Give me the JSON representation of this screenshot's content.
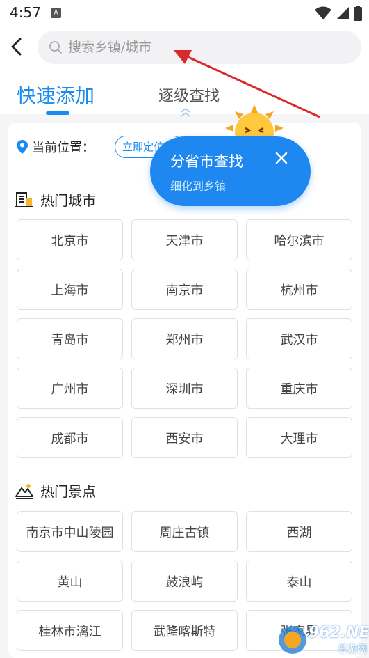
{
  "status_bar": {
    "time": "4:57",
    "app_icon": "A"
  },
  "search": {
    "placeholder": "搜索乡镇/城市"
  },
  "tabs": [
    {
      "label": "快速添加",
      "active": true
    },
    {
      "label": "逐级查找",
      "active": false
    }
  ],
  "location": {
    "label": "当前位置：",
    "button_label": "立即定位"
  },
  "tooltip": {
    "title": "分省市查找",
    "subtitle": "细化到乡镇",
    "close_icon": "close-icon"
  },
  "hot_cities": {
    "title": "热门城市",
    "items": [
      "北京市",
      "天津市",
      "哈尔滨市",
      "上海市",
      "南京市",
      "杭州市",
      "青岛市",
      "郑州市",
      "武汉市",
      "广州市",
      "深圳市",
      "重庆市",
      "成都市",
      "西安市",
      "大理市"
    ]
  },
  "hot_spots": {
    "title": "热门景点",
    "items": [
      "南京市中山陵园",
      "周庄古镇",
      "西湖",
      "黄山",
      "鼓浪屿",
      "泰山",
      "桂林市漓江",
      "武隆喀斯特",
      "张家界"
    ]
  },
  "watermark": {
    "text": "962.NET",
    "sub": "乐游网"
  },
  "colors": {
    "accent": "#1a8cf0",
    "tooltip": "#1f88f0",
    "annotation_arrow": "#d92b2b"
  }
}
